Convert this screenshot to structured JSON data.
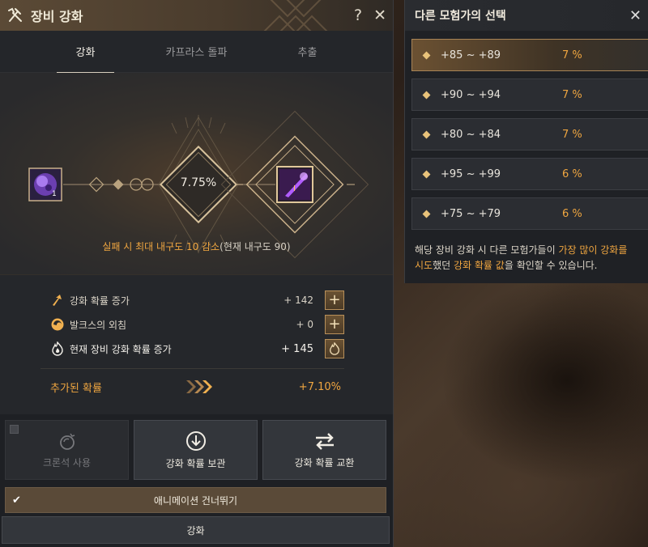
{
  "window": {
    "title": "장비 강화",
    "help_label": "?",
    "close_label": "✕"
  },
  "tabs": [
    {
      "label": "강화",
      "active": true
    },
    {
      "label": "카프라스 돌파",
      "active": false
    },
    {
      "label": "추출",
      "active": false
    }
  ],
  "stage": {
    "success_rate": "7.75%",
    "stone_count": "1",
    "fail_text_orange": "실패 시 최대 내구도 10 감소",
    "fail_text_gray": "(현재 내구도 90)"
  },
  "stats": {
    "rows": [
      {
        "label": "강화 확률 증가",
        "value": "+ 142",
        "icon": "arrow-up-icon"
      },
      {
        "label": "발크스의 외침",
        "value": "+ 0",
        "icon": "valks-icon"
      },
      {
        "label": "현재 장비 강화 확률 증가",
        "value": "+ 145",
        "icon": "flame-icon"
      }
    ],
    "plus_label": "+",
    "added_label": "추가된 확률",
    "added_value": "+7.10%"
  },
  "actions": {
    "cron_label": "크론석 사용",
    "store_label": "강화 확률 보관",
    "exchange_label": "강화 확률 교환"
  },
  "skip_animation": {
    "label": "애니메이션 건너뛰기",
    "check": "✔"
  },
  "enhance_label": "강화",
  "side_panel": {
    "title": "다른 모험가의 선택",
    "close_label": "✕",
    "options": [
      {
        "range": "+85 ~ +89",
        "prob": "7 %",
        "selected": true
      },
      {
        "range": "+90 ~ +94",
        "prob": "7 %",
        "selected": false
      },
      {
        "range": "+80 ~ +84",
        "prob": "7 %",
        "selected": false
      },
      {
        "range": "+95 ~ +99",
        "prob": "6 %",
        "selected": false
      },
      {
        "range": "+75 ~ +79",
        "prob": "6 %",
        "selected": false
      }
    ],
    "note_1": "해당 장비 강화 시 다른 모험가들이 ",
    "note_hl_1": "가장 많이 강화를",
    "note_hl_2": "시도",
    "note_2": "했던 ",
    "note_hl_3": "강화 확률 값",
    "note_3": "을 확인할 수 있습니다."
  },
  "colors": {
    "accent": "#f0a640",
    "title_bar": "#5b4a36",
    "panel_bg": "#1e2024"
  }
}
